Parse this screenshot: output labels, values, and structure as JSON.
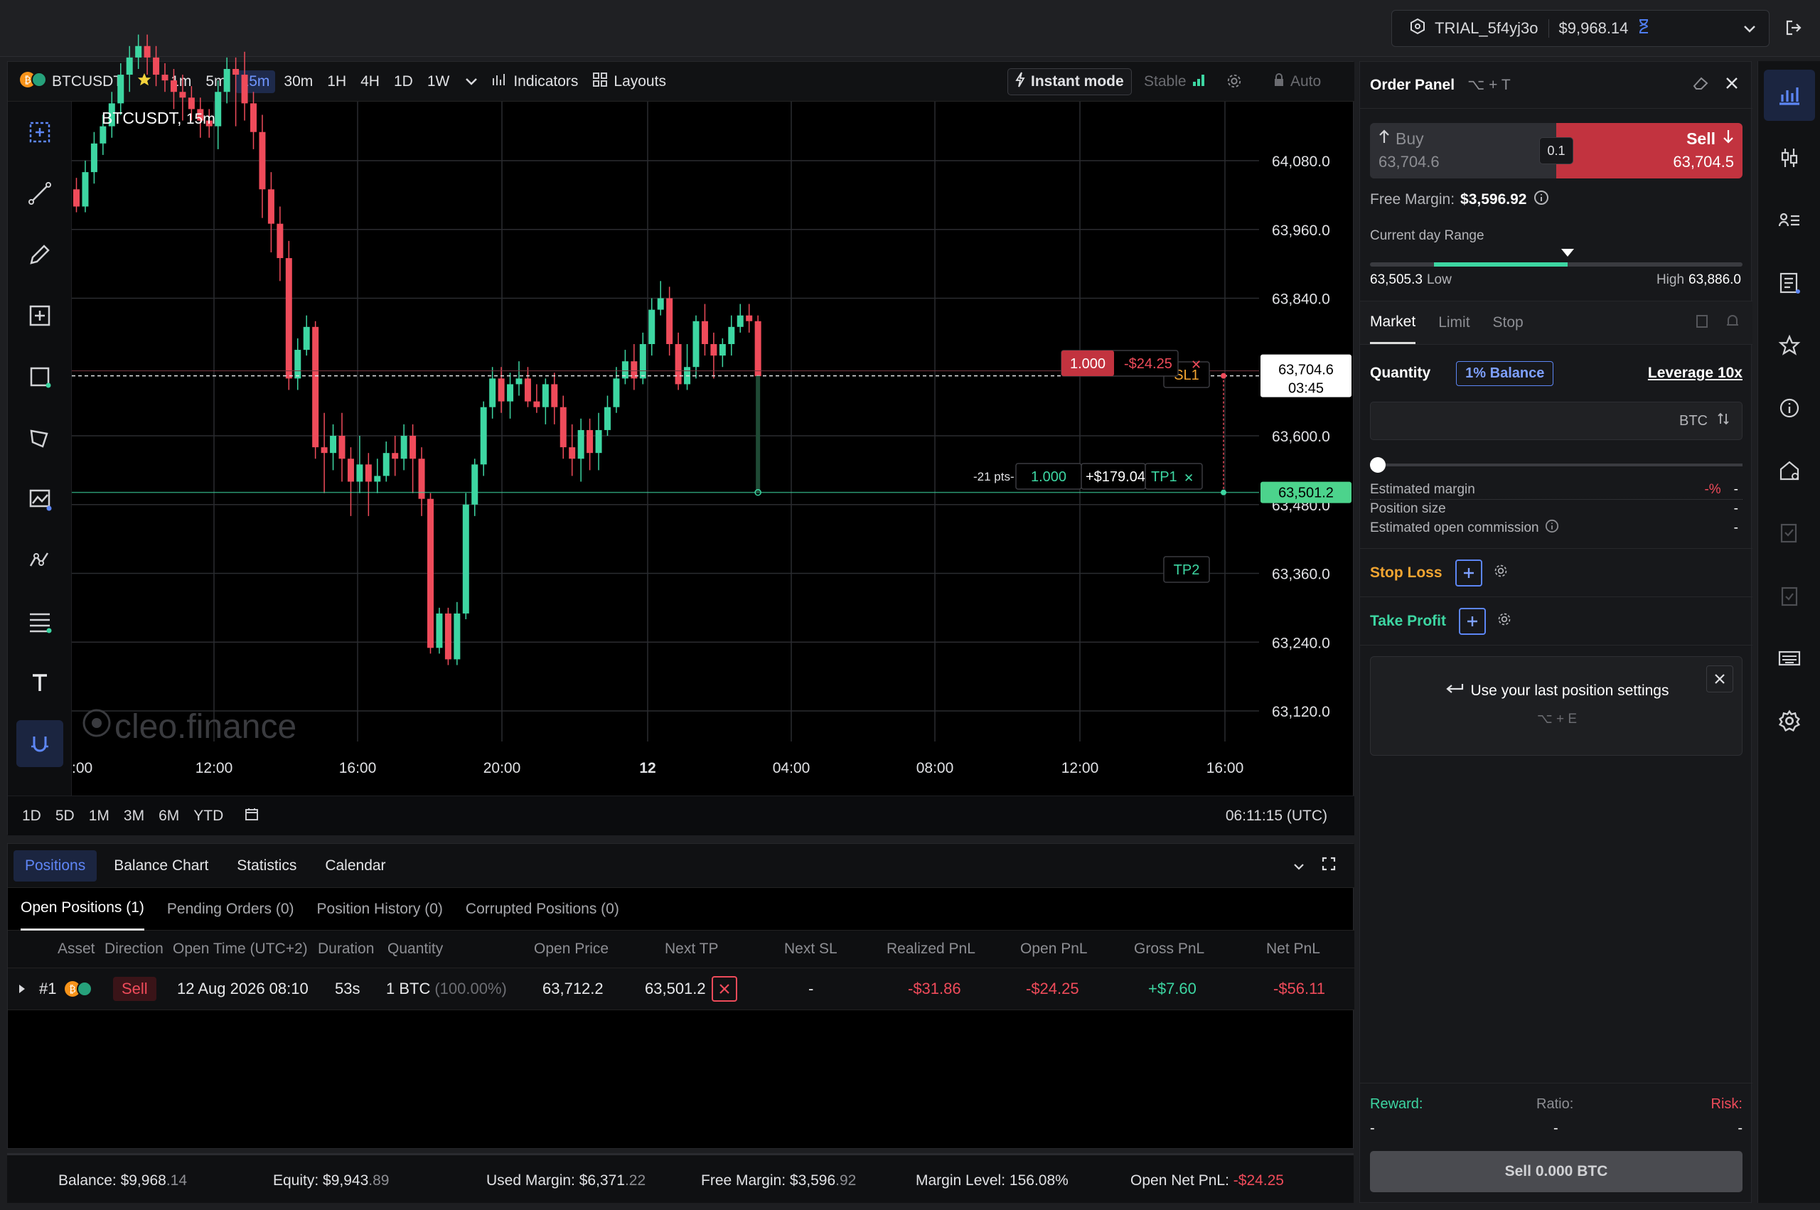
{
  "account": {
    "name": "TRIAL_5f4yj3o",
    "balance": "$9,968.14"
  },
  "toolbar": {
    "symbol": "BTCUSDT",
    "timeframes": [
      "1m",
      "5m",
      "15m",
      "30m",
      "1H",
      "4H",
      "1D",
      "1W"
    ],
    "active_timeframe": "15m",
    "indicators_label": "Indicators",
    "layouts_label": "Layouts",
    "instant_mode_label": "Instant mode",
    "stable_label": "Stable",
    "auto_label": "Auto"
  },
  "chart": {
    "legend": "BTCUSDT",
    "legend_tf": "15m",
    "watermark": "cleo.finance",
    "price_labels": [
      "64,080.0",
      "63,960.0",
      "63,840.0",
      "63,600.0",
      "63,480.0",
      "63,360.0",
      "63,240.0",
      "63,120.0"
    ],
    "time_labels": [
      ":00",
      "12:00",
      "16:00",
      "20:00",
      "12",
      "04:00",
      "08:00",
      "12:00",
      "16:00"
    ],
    "current_price": "63,704.6",
    "countdown": "03:45",
    "tp_price": "63,501.2",
    "sl1_label": "SL1",
    "tp2_label": "TP2",
    "position_qty": "1.000",
    "position_pnl": "-$24.25",
    "tp_pts": "-21 pts-",
    "tp_qty": "1.000",
    "tp_pnl": "+$179.04",
    "tp1_label": "TP1",
    "colors": {
      "up": "#3dd6a2",
      "down": "#ef4b5a"
    }
  },
  "chart_data": {
    "type": "candlestick",
    "symbol": "BTCUSDT",
    "interval": "15m",
    "y_ticks": [
      64080,
      63960,
      63840,
      63600,
      63480,
      63360,
      63240,
      63120
    ],
    "x_ticks": [
      ":00",
      "12:00",
      "16:00",
      "20:00",
      "12",
      "04:00",
      "08:00",
      "12:00",
      "16:00"
    ],
    "current_price": 63704.6,
    "tp_price": 63501.2
  },
  "chart_bottom": {
    "ranges": [
      "1D",
      "5D",
      "1M",
      "3M",
      "6M",
      "YTD"
    ],
    "clock": "06:11:15 (UTC)"
  },
  "positions": {
    "tabs": [
      "Positions",
      "Balance Chart",
      "Statistics",
      "Calendar"
    ],
    "subtabs": [
      "Open Positions (1)",
      "Pending Orders (0)",
      "Position History (0)",
      "Corrupted Positions (0)"
    ],
    "headers": [
      "Asset",
      "Direction",
      "Open Time (UTC+2)",
      "Duration",
      "Quantity",
      "Open Price",
      "Next TP",
      "Next SL",
      "Realized PnL",
      "Open PnL",
      "Gross PnL",
      "Net PnL"
    ],
    "row": {
      "id": "#1",
      "direction": "Sell",
      "open_time": "12 Aug 2026 08:10",
      "duration": "53s",
      "quantity": "1 BTC",
      "quantity_pct": "(100.00%)",
      "open_price": "63,712.2",
      "next_tp": "63,501.2",
      "next_sl": "-",
      "realized_pnl": "-$31.86",
      "open_pnl": "-$24.25",
      "gross_pnl": "+$7.60",
      "net_pnl": "-$56.11"
    }
  },
  "footer": {
    "balance_label": "Balance:",
    "balance_main": "$9,968",
    "balance_dec": ".14",
    "equity_label": "Equity:",
    "equity_main": "$9,943",
    "equity_dec": ".89",
    "used_margin_label": "Used Margin:",
    "used_margin_main": "$6,371",
    "used_margin_dec": ".22",
    "free_margin_label": "Free Margin:",
    "free_margin_main": "$3,596",
    "free_margin_dec": ".92",
    "margin_level_label": "Margin Level:",
    "margin_level": "156.08%",
    "open_net_pnl_label": "Open Net PnL:",
    "open_net_pnl": "-$24.25"
  },
  "order_panel": {
    "title": "Order Panel",
    "shortcut": "⌥ + T",
    "buy_label": "Buy",
    "buy_price": "63,704.6",
    "spread": "0.1",
    "sell_label": "Sell",
    "sell_price": "63,704.5",
    "free_margin_label": "Free Margin:",
    "free_margin_value": "$3,596.92",
    "range_label": "Current day Range",
    "range_low": "63,505.3",
    "range_low_label": "Low",
    "range_high_label": "High",
    "range_high": "63,886.0",
    "range_position": 0.53,
    "order_tabs": [
      "Market",
      "Limit",
      "Stop"
    ],
    "quantity_label": "Quantity",
    "balance_btn": "1% Balance",
    "leverage": "Leverage 10x",
    "unit": "BTC",
    "est_margin_label": "Estimated margin",
    "est_margin_value": "-%",
    "est_margin_dash": "-",
    "position_size_label": "Position size",
    "position_size_value": "-",
    "commission_label": "Estimated open commission",
    "commission_value": "-",
    "stop_loss_label": "Stop Loss",
    "take_profit_label": "Take Profit",
    "last_settings_label": "Use your last position settings",
    "last_settings_shortcut": "⌥ + E",
    "reward_label": "Reward:",
    "ratio_label": "Ratio:",
    "risk_label": "Risk:",
    "reward_value": "-",
    "ratio_value": "-",
    "risk_value": "-",
    "submit_label": "Sell 0.000 BTC"
  }
}
